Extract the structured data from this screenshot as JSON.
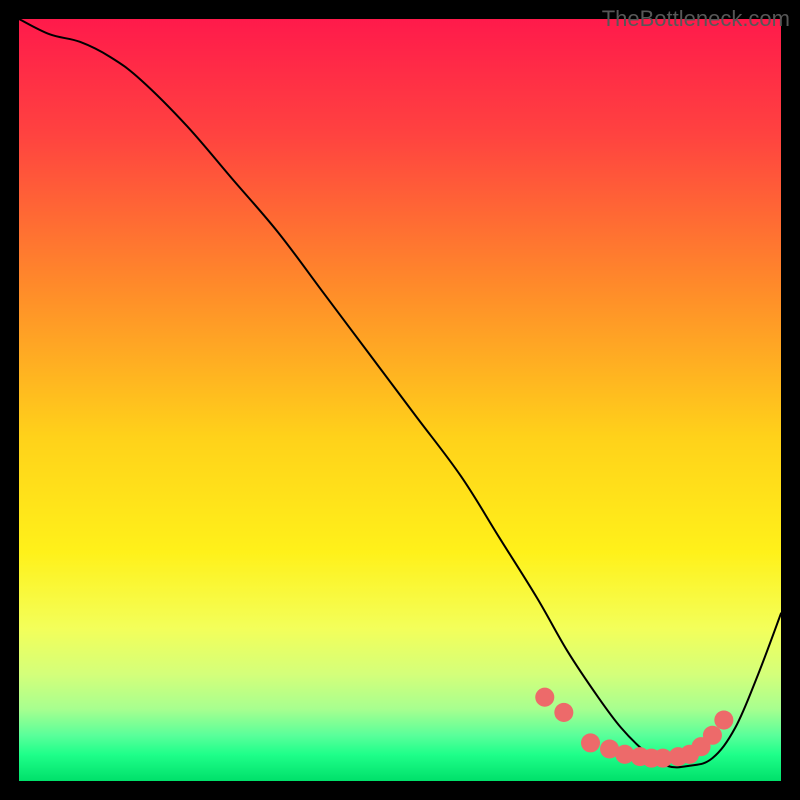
{
  "watermark": "TheBottleneck.com",
  "chart_data": {
    "type": "line",
    "title": "",
    "xlabel": "",
    "ylabel": "",
    "xlim": [
      0,
      100
    ],
    "ylim": [
      0,
      100
    ],
    "grid": false,
    "legend": false,
    "background_gradient": {
      "stops": [
        {
          "offset": 0.0,
          "color": "#ff1a4b"
        },
        {
          "offset": 0.15,
          "color": "#ff4240"
        },
        {
          "offset": 0.35,
          "color": "#ff8a2a"
        },
        {
          "offset": 0.55,
          "color": "#ffd21a"
        },
        {
          "offset": 0.7,
          "color": "#fff11a"
        },
        {
          "offset": 0.8,
          "color": "#f3ff5a"
        },
        {
          "offset": 0.86,
          "color": "#d4ff7a"
        },
        {
          "offset": 0.905,
          "color": "#a8ff8f"
        },
        {
          "offset": 0.94,
          "color": "#5aff9a"
        },
        {
          "offset": 0.965,
          "color": "#1fff8a"
        },
        {
          "offset": 1.0,
          "color": "#00e06a"
        }
      ]
    },
    "series": [
      {
        "name": "bottleneck-curve",
        "style": "line",
        "x": [
          0,
          4,
          8,
          12,
          16,
          22,
          28,
          34,
          40,
          46,
          52,
          58,
          63,
          68,
          72,
          76,
          79,
          82,
          85,
          88,
          91,
          94,
          97,
          100
        ],
        "y": [
          100,
          98,
          97,
          95,
          92,
          86,
          79,
          72,
          64,
          56,
          48,
          40,
          32,
          24,
          17,
          11,
          7,
          4,
          2,
          2,
          3,
          7,
          14,
          22
        ]
      },
      {
        "name": "optimal-range-points",
        "style": "scatter",
        "x": [
          69,
          71.5,
          75,
          77.5,
          79.5,
          81.5,
          83,
          84.5,
          86.5,
          88,
          89.5,
          91,
          92.5
        ],
        "y": [
          11,
          9,
          5,
          4.2,
          3.5,
          3.2,
          3,
          3,
          3.2,
          3.5,
          4.5,
          6,
          8
        ]
      }
    ]
  }
}
